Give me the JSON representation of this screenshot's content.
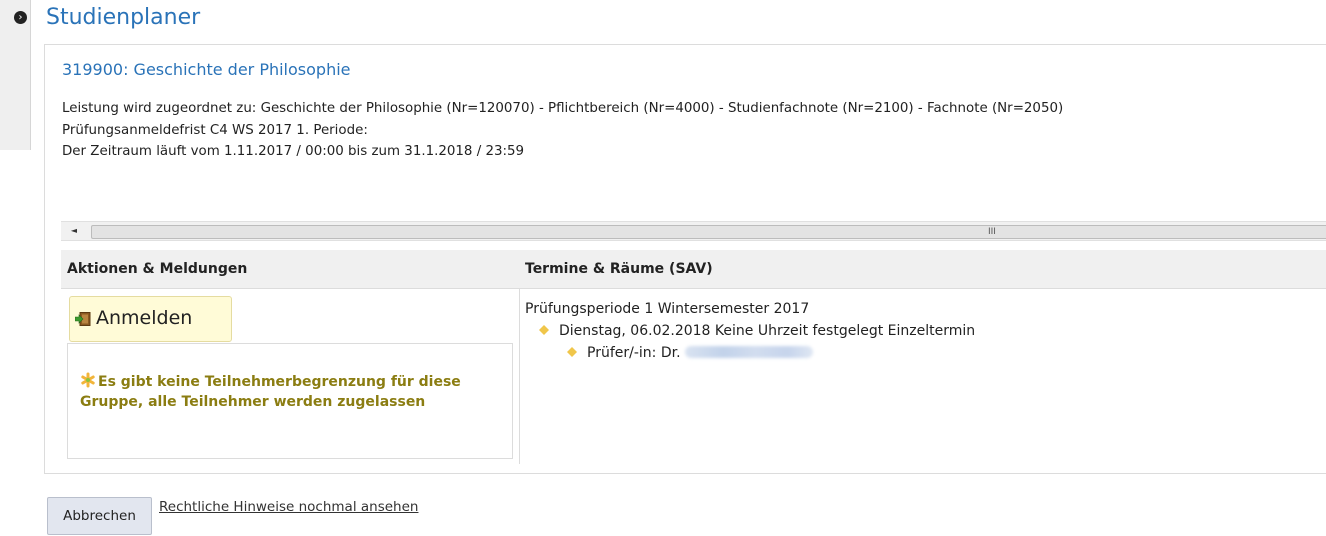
{
  "page": {
    "title": "Studienplaner"
  },
  "module": {
    "title": "319900: Geschichte der Philosophie",
    "info": [
      "Leistung wird zugeordnet zu: Geschichte der Philosophie (Nr=120070) - Pflichtbereich (Nr=4000) - Studienfachnote (Nr=2100) - Fachnote (Nr=2050)",
      "Prüfungsanmeldefrist C4 WS 2017 1. Periode:",
      "Der Zeitraum läuft vom 1.11.2017 / 00:00 bis zum 31.1.2018 / 23:59"
    ]
  },
  "scrollbar": {
    "left_arrow": "◄",
    "grip": "III"
  },
  "table": {
    "headers": [
      "Aktionen & Meldungen",
      "Termine & Räume (SAV)"
    ],
    "register_label": "Anmelden",
    "notice": "Es gibt keine Teilnehmerbegrenzung für diese Gruppe, alle Teilnehmer werden zugelassen",
    "termine": {
      "period": "Prüfungsperiode 1 Wintersemester 2017",
      "date_entry": "Dienstag, 06.02.2018 Keine Uhrzeit festgelegt Einzeltermin",
      "examiner_prefix": "Prüfer/-in: Dr."
    }
  },
  "footer": {
    "cancel_label": "Abbrechen",
    "legal_link": "Rechtliche Hinweise nochmal ansehen"
  },
  "icons": {
    "toggle": "collapse-toggle-icon",
    "register": "door-enter-icon",
    "notice": "asterisk-notice-icon",
    "bullet": "diamond-bullet-icon"
  },
  "colors": {
    "link_blue": "#2a73b8",
    "notice_text": "#8b7d12",
    "register_bg": "#fffbd7",
    "bullet": "#f0c64a"
  }
}
